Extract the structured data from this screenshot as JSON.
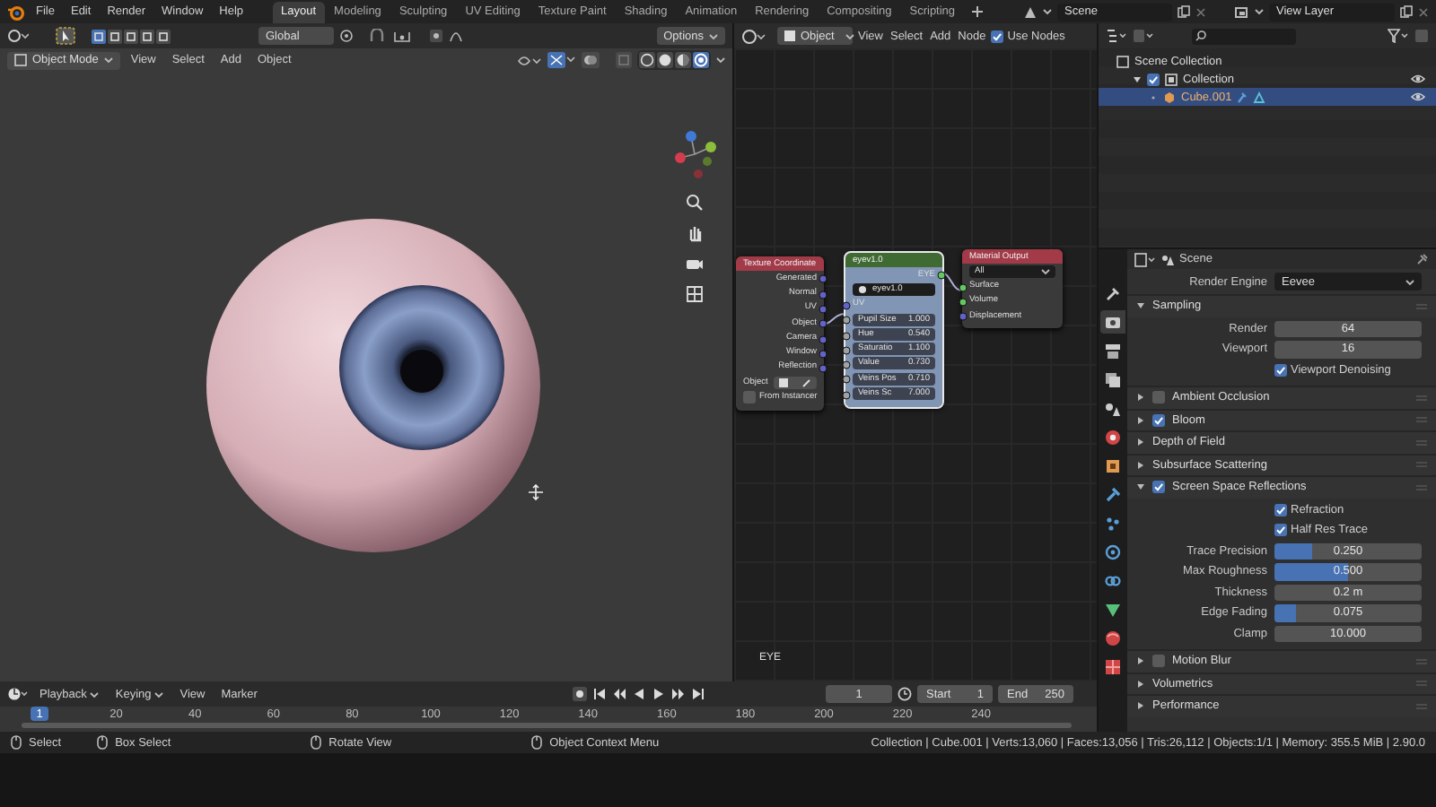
{
  "topbar": {
    "menus": [
      "File",
      "Edit",
      "Render",
      "Window",
      "Help"
    ],
    "workspaces": [
      {
        "label": "Layout",
        "selected": true
      },
      {
        "label": "Modeling",
        "selected": false
      },
      {
        "label": "Sculpting",
        "selected": false
      },
      {
        "label": "UV Editing",
        "selected": false
      },
      {
        "label": "Texture Paint",
        "selected": false
      },
      {
        "label": "Shading",
        "selected": false
      },
      {
        "label": "Animation",
        "selected": false
      },
      {
        "label": "Rendering",
        "selected": false
      },
      {
        "label": "Compositing",
        "selected": false
      },
      {
        "label": "Scripting",
        "selected": false
      }
    ],
    "scene": "Scene",
    "view_layer": "View Layer"
  },
  "viewport": {
    "transform_orientation": "Global",
    "options": "Options",
    "mode": "Object Mode",
    "menus": [
      "View",
      "Select",
      "Add",
      "Object"
    ],
    "shading_modes": [
      {
        "kind": "wireframe",
        "selected": false
      },
      {
        "kind": "solid",
        "selected": false
      },
      {
        "kind": "material",
        "selected": false
      },
      {
        "kind": "rendered",
        "selected": true
      }
    ]
  },
  "node_editor": {
    "object_type": "Object",
    "menus": [
      "View",
      "Select",
      "Add",
      "Node"
    ],
    "use_nodes": {
      "label": "Use Nodes",
      "checked": true
    },
    "tree_name": "EYE",
    "nodes": [
      {
        "kind": "texture_coordinate",
        "title": "Texture Coordinate",
        "color": "#a33a48",
        "selected": false,
        "outputs": [
          {
            "label": "Generated",
            "kind": "vector"
          },
          {
            "label": "Normal",
            "kind": "vector"
          },
          {
            "label": "UV",
            "kind": "vector"
          },
          {
            "label": "Object",
            "kind": "vector"
          },
          {
            "label": "Camera",
            "kind": "vector"
          },
          {
            "label": "Window",
            "kind": "vector"
          },
          {
            "label": "Reflection",
            "kind": "vector"
          }
        ],
        "object_label": "Object",
        "instancer": {
          "label": "From Instancer",
          "checked": false
        }
      },
      {
        "kind": "group",
        "title": "eyev1.0",
        "color": "#3f6b33",
        "selected": true,
        "outputs": [
          {
            "label": "EYE",
            "kind": "shader"
          }
        ],
        "datablock": "eyev1.0",
        "inputs": [
          {
            "label": "UV",
            "kind": "vector"
          },
          {
            "label": "Pupil Size",
            "value": "1.000",
            "kind": "float"
          },
          {
            "label": "Hue",
            "value": "0.540",
            "kind": "float"
          },
          {
            "label": "Saturatio",
            "value": "1.100",
            "kind": "float"
          },
          {
            "label": "Value",
            "value": "0.730",
            "kind": "float"
          },
          {
            "label": "Veins Pos",
            "value": "0.710",
            "kind": "float"
          },
          {
            "label": "Veins Sc",
            "value": "7.000",
            "kind": "float"
          }
        ]
      },
      {
        "kind": "output",
        "title": "Material Output",
        "color": "#a33a48",
        "selected": false,
        "target": "All",
        "inputs": [
          {
            "label": "Surface",
            "kind": "shader"
          },
          {
            "label": "Volume",
            "kind": "shader"
          },
          {
            "label": "Displacement",
            "kind": "vector"
          }
        ]
      }
    ]
  },
  "outliner": {
    "tree": [
      {
        "label": "Scene Collection",
        "kind": "scene",
        "selected": false,
        "children": [
          {
            "label": "Collection",
            "kind": "collection",
            "selected": false,
            "checked": true,
            "children": [
              {
                "label": "Cube.001",
                "kind": "object",
                "selected": true
              }
            ]
          }
        ]
      }
    ]
  },
  "properties": {
    "context": "Scene",
    "tabs": [
      {
        "kind": "tool",
        "selected": false
      },
      {
        "kind": "render",
        "selected": true
      },
      {
        "kind": "output",
        "selected": false
      },
      {
        "kind": "view_layer",
        "selected": false
      },
      {
        "kind": "scene",
        "selected": false
      },
      {
        "kind": "world",
        "selected": false
      },
      {
        "kind": "object",
        "selected": false
      },
      {
        "kind": "modifier",
        "selected": false
      },
      {
        "kind": "particles",
        "selected": false
      },
      {
        "kind": "physics",
        "selected": false
      },
      {
        "kind": "constraint",
        "selected": false
      },
      {
        "kind": "data",
        "selected": false
      },
      {
        "kind": "material",
        "selected": false
      },
      {
        "kind": "texture",
        "selected": false
      }
    ],
    "render_engine": {
      "label": "Render Engine",
      "value": "Eevee"
    },
    "panels": [
      {
        "label": "Sampling",
        "expanded": true,
        "rows": [
          {
            "kind": "number",
            "label": "Render",
            "value": "64"
          },
          {
            "kind": "number",
            "label": "Viewport",
            "value": "16"
          },
          {
            "kind": "checkbox",
            "label": "Viewport Denoising",
            "checked": true
          }
        ]
      },
      {
        "label": "Ambient Occlusion",
        "expanded": false,
        "enabled": false
      },
      {
        "label": "Bloom",
        "expanded": false,
        "enabled": true
      },
      {
        "label": "Depth of Field",
        "expanded": false
      },
      {
        "label": "Subsurface Scattering",
        "expanded": false
      },
      {
        "label": "Screen Space Reflections",
        "expanded": true,
        "enabled": true,
        "rows": [
          {
            "kind": "checkbox",
            "label": "Refraction",
            "checked": true
          },
          {
            "kind": "checkbox",
            "label": "Half Res Trace",
            "checked": true
          },
          {
            "kind": "slider",
            "label": "Trace Precision",
            "value": "0.250",
            "level": 0.25
          },
          {
            "kind": "slider",
            "label": "Max Roughness",
            "value": "0.500",
            "level": 0.5
          },
          {
            "kind": "number",
            "label": "Thickness",
            "value": "0.2 m"
          },
          {
            "kind": "slider",
            "label": "Edge Fading",
            "value": "0.075",
            "level": 0.15
          },
          {
            "kind": "number",
            "label": "Clamp",
            "value": "10.000"
          }
        ]
      },
      {
        "label": "Motion Blur",
        "expanded": false,
        "enabled": false
      },
      {
        "label": "Volumetrics",
        "expanded": false
      },
      {
        "label": "Performance",
        "expanded": false
      }
    ]
  },
  "timeline": {
    "menus": [
      {
        "label": "Playback",
        "dropdown": true
      },
      {
        "label": "Keying",
        "dropdown": true
      },
      {
        "label": "View",
        "dropdown": false
      },
      {
        "label": "Marker",
        "dropdown": false
      }
    ],
    "current_frame": "1",
    "start": {
      "label": "Start",
      "value": "1"
    },
    "end": {
      "label": "End",
      "value": "250"
    },
    "ruler": {
      "current": "1",
      "ticks": [
        "20",
        "40",
        "60",
        "80",
        "100",
        "120",
        "140",
        "160",
        "180",
        "200",
        "220",
        "240"
      ]
    }
  },
  "status_bar": {
    "actions": [
      {
        "label": "Select",
        "kind": "left"
      },
      {
        "label": "Box Select",
        "kind": "drag"
      },
      {
        "label": "Rotate View",
        "kind": "middle"
      },
      {
        "label": "Object Context Menu",
        "kind": "right"
      }
    ],
    "stats": "Collection | Cube.001 | Verts:13,060 | Faces:13,056 | Tris:26,112 | Objects:1/1 | Memory: 355.5 MiB | 2.90.0"
  }
}
